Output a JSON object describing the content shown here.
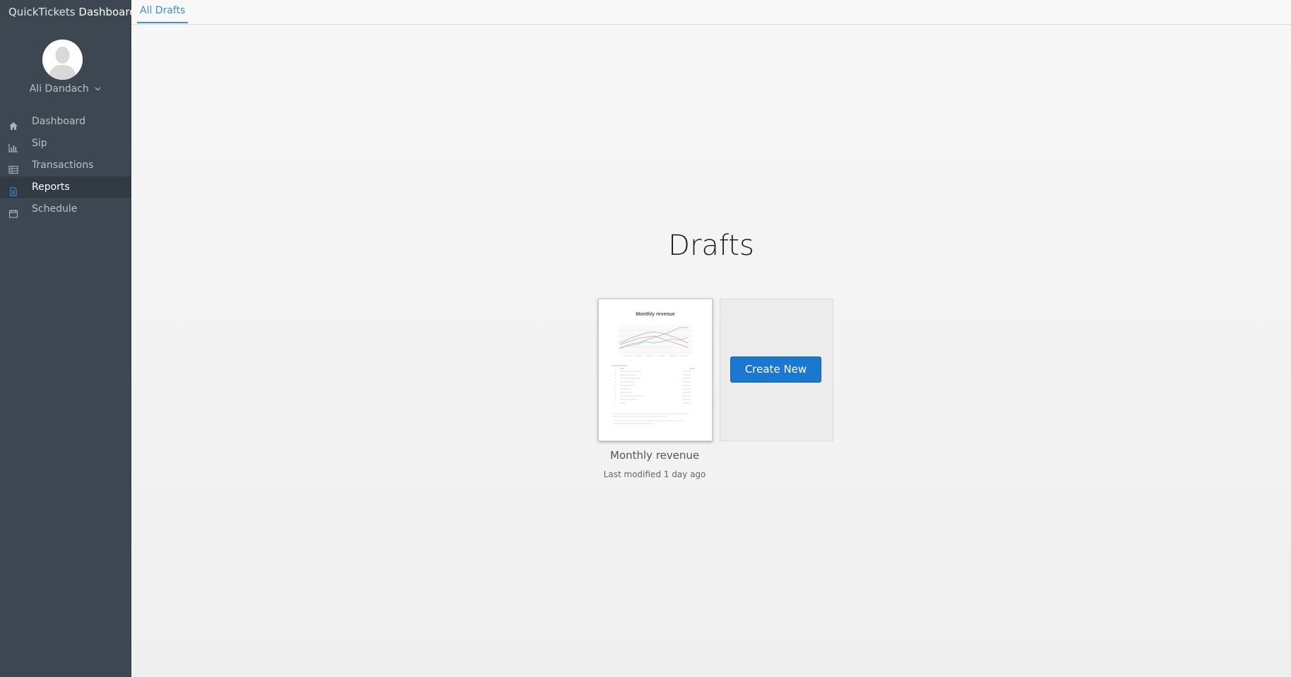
{
  "app": {
    "brand_light": "QuickTickets",
    "brand_strong": "Dashboard"
  },
  "user": {
    "name": "Ali Dandach"
  },
  "sidebar": {
    "items": [
      {
        "label": "Dashboard",
        "icon": "home-icon",
        "active": false
      },
      {
        "label": "Sip",
        "icon": "bar-chart-icon",
        "active": false
      },
      {
        "label": "Transactions",
        "icon": "table-icon",
        "active": false
      },
      {
        "label": "Reports",
        "icon": "document-icon",
        "active": true
      },
      {
        "label": "Schedule",
        "icon": "calendar-icon",
        "active": false
      }
    ]
  },
  "tabs": [
    {
      "label": "All Drafts",
      "active": true
    }
  ],
  "main": {
    "title": "Drafts",
    "drafts": [
      {
        "name": "Monthly revenue",
        "modified": "Last modified 1 day ago",
        "thumbnail_title": "Monthly revenue"
      }
    ],
    "create_button": "Create New"
  },
  "colors": {
    "sidebar_bg": "#3d4751",
    "sidebar_active_bg": "#323b44",
    "accent": "#3c8fd8",
    "button": "#1b78d0"
  }
}
